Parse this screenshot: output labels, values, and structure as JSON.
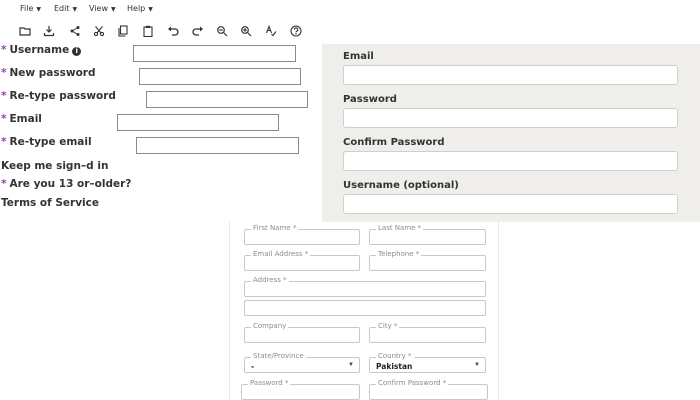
{
  "menu": [
    {
      "label": "File"
    },
    {
      "label": "Edit"
    },
    {
      "label": "View"
    },
    {
      "label": "Help"
    }
  ],
  "toolbar": [
    {
      "icon": "folder-open-icon",
      "glyph": "🗀"
    },
    {
      "icon": "download-icon",
      "glyph": "⭳"
    },
    {
      "icon": "share-icon",
      "glyph": "⋖"
    },
    {
      "icon": "scissors-icon",
      "glyph": "✂"
    },
    {
      "icon": "copy-icon",
      "glyph": "❐"
    },
    {
      "icon": "paste-icon",
      "glyph": "📋"
    },
    {
      "icon": "undo-icon",
      "glyph": "↶"
    },
    {
      "icon": "redo-icon",
      "glyph": "↷"
    },
    {
      "icon": "zoom-out-icon",
      "glyph": "🔍"
    },
    {
      "icon": "zoom-in-icon",
      "glyph": "🔍"
    },
    {
      "icon": "spellcheck-icon",
      "glyph": "A"
    },
    {
      "icon": "help-icon",
      "glyph": "?"
    }
  ],
  "left_form": {
    "required_mark": "*",
    "username": "Username",
    "new_password": "New password",
    "retype_password": "Re-type password",
    "email": "Email",
    "retype_email": "Re-type email",
    "keep_signed_in": "Keep me sign–d in",
    "age_question": "Are you 13 or–older?",
    "terms": "Terms of Service"
  },
  "right_panel": {
    "email": "Email",
    "password": "Password",
    "confirm_password": "Confirm Password",
    "username_optional": "Username (optional)"
  },
  "card": {
    "first_name": "First Name *",
    "last_name": "Last Name *",
    "email_address": "Email Address *",
    "telephone": "Telephone *",
    "address": "Address *",
    "company": "Company",
    "city": "City *",
    "state": "State/Province",
    "state_value": "-",
    "country": "Country *",
    "country_value": "Pakistan",
    "password": "Password *",
    "confirm_password": "Confirm Password *"
  }
}
